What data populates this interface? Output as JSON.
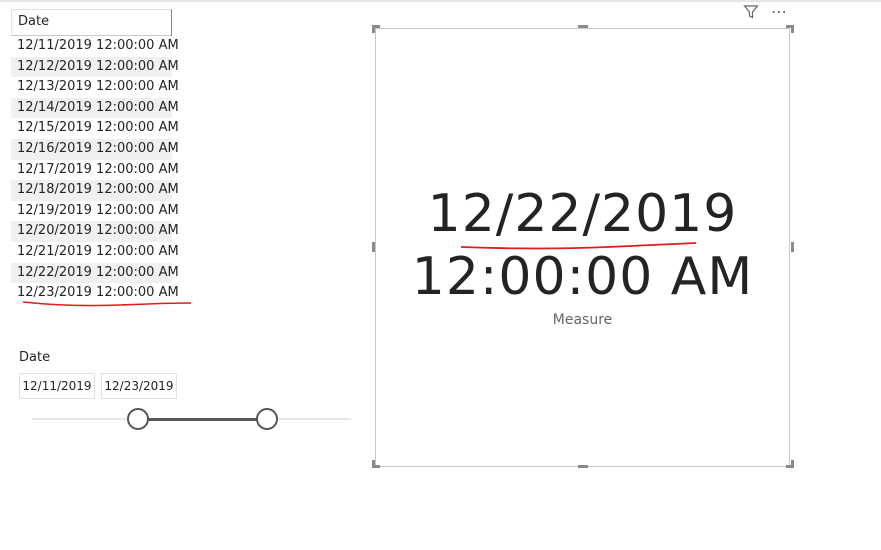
{
  "table": {
    "header": "Date",
    "rows": [
      "12/11/2019 12:00:00 AM",
      "12/12/2019 12:00:00 AM",
      "12/13/2019 12:00:00 AM",
      "12/14/2019 12:00:00 AM",
      "12/15/2019 12:00:00 AM",
      "12/16/2019 12:00:00 AM",
      "12/17/2019 12:00:00 AM",
      "12/18/2019 12:00:00 AM",
      "12/19/2019 12:00:00 AM",
      "12/20/2019 12:00:00 AM",
      "12/21/2019 12:00:00 AM",
      "12/22/2019 12:00:00 AM",
      "12/23/2019 12:00:00 AM"
    ]
  },
  "slicer": {
    "title": "Date",
    "start_date": "12/11/2019",
    "end_date": "12/23/2019"
  },
  "card": {
    "value_line1": "12/22/2019",
    "value_line2": "12:00:00 AM",
    "label": "Measure"
  },
  "colors": {
    "annotation": "#e31b1b",
    "accent": "#3a96dd"
  },
  "icons": {
    "filter": "filter-icon",
    "more": "more-options-icon"
  }
}
